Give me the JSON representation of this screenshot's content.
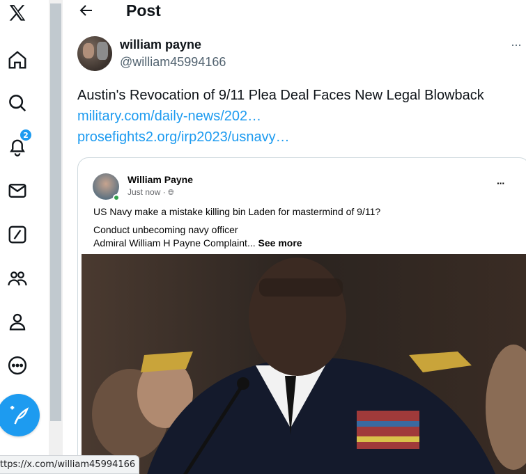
{
  "nav": {
    "icons": [
      "x-logo-icon",
      "home-icon",
      "search-icon",
      "bell-icon",
      "mail-icon",
      "grok-icon",
      "communities-icon",
      "profile-icon",
      "more-icon"
    ],
    "notifications_badge": "2",
    "post_button_icon": "feather-plus-icon"
  },
  "header": {
    "title": "Post"
  },
  "tweet": {
    "author_name": "william payne",
    "author_handle": "@william45994166",
    "text": "Austin's Revocation of 9/11 Plea Deal Faces New Legal Blowback",
    "links": [
      "military.com/daily-news/202…",
      "prosefights2.org/irp2023/usnavy…"
    ],
    "more": "···"
  },
  "embed": {
    "name": "William Payne",
    "time": "Just now ·",
    "more": "···",
    "line1": "US Navy make a mistake killing bin Laden for mastermind of 9/11?",
    "line2": "Conduct unbecoming navy officer",
    "line3": "Admiral William H Payne Complaint...",
    "see_more": "See more"
  },
  "status_bar": {
    "url": "ttps://x.com/william45994166"
  },
  "colors": {
    "accent": "#1d9bf0",
    "text": "#0f1419",
    "muted": "#536471"
  }
}
